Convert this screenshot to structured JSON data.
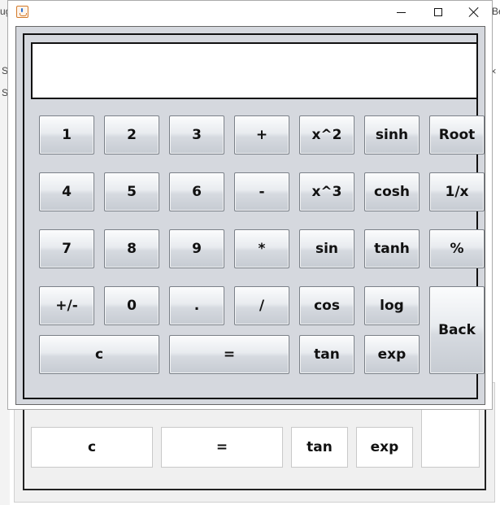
{
  "background": {
    "fragments": [
      "ug",
      "Be",
      "S",
      "S"
    ],
    "buttons": {
      "c": "c",
      "equals": "=",
      "tan": "tan",
      "exp": "exp",
      "back": "Back"
    }
  },
  "calculator": {
    "display_value": "",
    "buttons": {
      "one": "1",
      "two": "2",
      "three": "3",
      "plus": "+",
      "square": "x^2",
      "sinh": "sinh",
      "root": "Root",
      "four": "4",
      "five": "5",
      "six": "6",
      "minus": "-",
      "cube": "x^3",
      "cosh": "cosh",
      "reciprocal": "1/x",
      "seven": "7",
      "eight": "8",
      "nine": "9",
      "multiply": "*",
      "sin": "sin",
      "tanh": "tanh",
      "percent": "%",
      "plus_minus": "+/-",
      "zero": "0",
      "decimal": ".",
      "divide": "/",
      "cos": "cos",
      "log": "log",
      "back": "Back",
      "clear": "c",
      "equals": "=",
      "tan": "tan",
      "exp": "exp"
    }
  }
}
